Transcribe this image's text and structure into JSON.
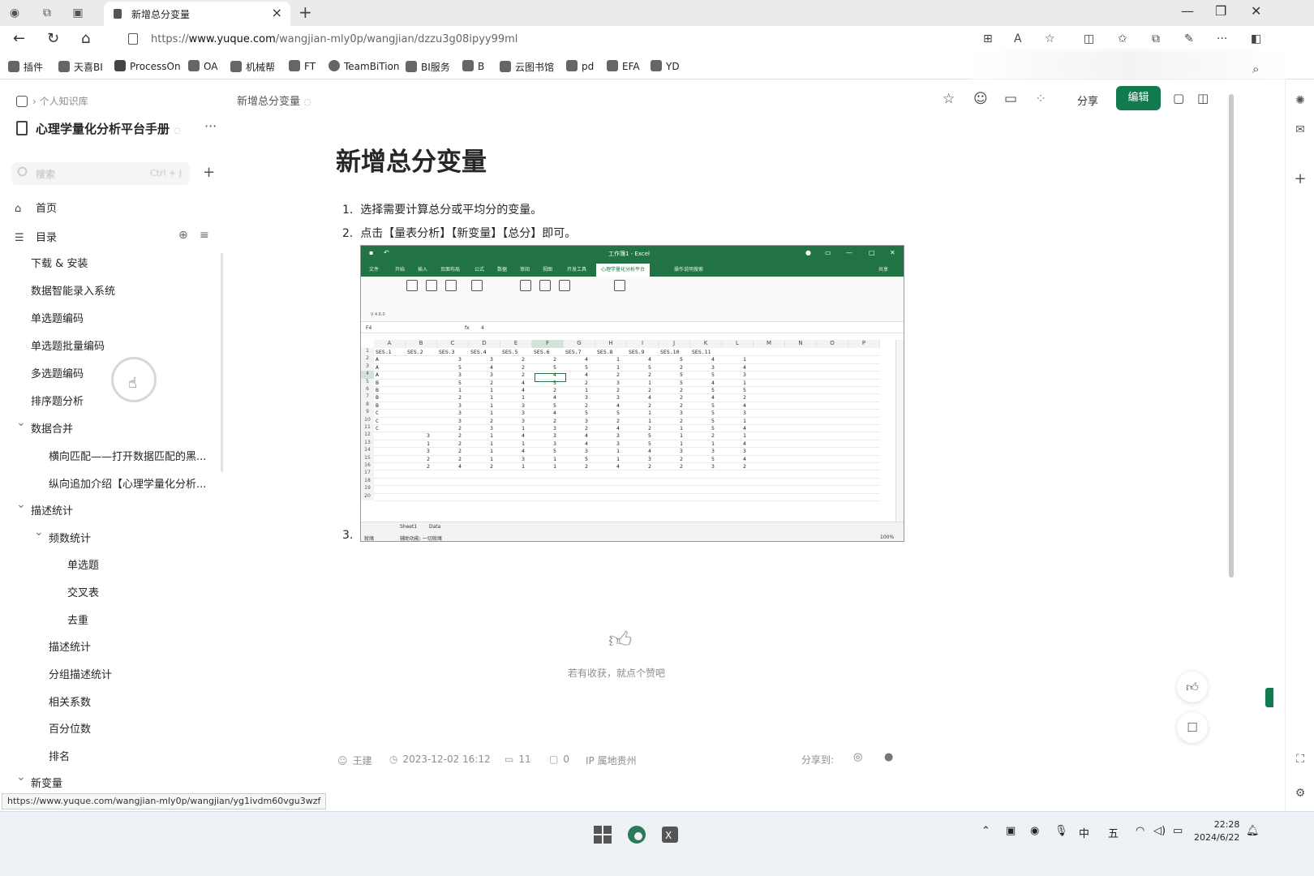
{
  "browser": {
    "tab_title": "新增总分变量",
    "url_prefix": "https://",
    "url_domain": "www.yuque.com",
    "url_path": "/wangjian-mly0p/wangjian/dzzu3g08ipyy99ml",
    "bookmarks": [
      "插件",
      "天喜BI",
      "ProcessOn",
      "OA",
      "机械帮",
      "FT",
      "TeamBiTion",
      "BI服务",
      "B",
      "云图书馆",
      "pd",
      "EFA",
      "YD"
    ],
    "status_url": "https://www.yuque.com/wangjian-mly0p/wangjian/yg1ivdm60vgu3wzf"
  },
  "sidebar": {
    "breadcrumb": "个人知识库",
    "kb_title": "心理学量化分析平台手册",
    "search_placeholder": "搜索",
    "search_shortcut": "Ctrl + J",
    "home": "首页",
    "toc_label": "目录",
    "toc": [
      {
        "label": "下载 & 安装",
        "level": 1
      },
      {
        "label": "数据智能录入系统",
        "level": 1
      },
      {
        "label": "单选题编码",
        "level": 1
      },
      {
        "label": "单选题批量编码",
        "level": 1
      },
      {
        "label": "多选题编码",
        "level": 1
      },
      {
        "label": "排序题分析",
        "level": 1
      },
      {
        "label": "数据合并",
        "level": 1,
        "expanded": true
      },
      {
        "label": "横向匹配——打开数据匹配的黑...",
        "level": 2
      },
      {
        "label": "纵向追加介绍【心理学量化分析...",
        "level": 2
      },
      {
        "label": "描述统计",
        "level": 1,
        "expanded": true
      },
      {
        "label": "频数统计",
        "level": 2,
        "expanded": true
      },
      {
        "label": "单选题",
        "level": 3
      },
      {
        "label": "交叉表",
        "level": 3
      },
      {
        "label": "去重",
        "level": 3
      },
      {
        "label": "描述统计",
        "level": 2
      },
      {
        "label": "分组描述统计",
        "level": 2
      },
      {
        "label": "相关系数",
        "level": 2
      },
      {
        "label": "百分位数",
        "level": 2
      },
      {
        "label": "排名",
        "level": 2
      },
      {
        "label": "新变量",
        "level": 1,
        "expanded": true
      }
    ]
  },
  "doc": {
    "header_title": "新增总分变量",
    "share_label": "分享",
    "edit_label": "编辑",
    "title": "新增总分变量",
    "steps": [
      "选择需要计算总分或平均分的变量。",
      "点击【量表分析】【新变量】【总分】即可。",
      ""
    ],
    "like_text": "若有收获，就点个赞吧",
    "author": "王建",
    "datetime": "2023-12-02 16:12",
    "views": "11",
    "comments": "0",
    "ip_location": "IP 属地贵州",
    "share_to": "分享到:"
  },
  "excel": {
    "title": "工作簿1 - Excel",
    "tabs": [
      "文件",
      "开始",
      "插入",
      "页面布局",
      "公式",
      "数据",
      "审阅",
      "视图",
      "开发工具",
      "心理学量化分析平台",
      "操作说明搜索"
    ],
    "share": "共享",
    "version": "V 4.6.0",
    "namebox": "F4",
    "formula": "4",
    "col_letters": [
      "A",
      "B",
      "C",
      "D",
      "E",
      "F",
      "G",
      "H",
      "I",
      "J",
      "K",
      "L",
      "M",
      "N",
      "O",
      "P"
    ],
    "headers": [
      "SES.1",
      "SES.2",
      "SES.3",
      "SES.4",
      "SES.5",
      "SES.6",
      "SES.7",
      "SES.8",
      "SES.9",
      "SES.10",
      "SES.11"
    ],
    "rows": [
      [
        "A",
        "",
        "3",
        "3",
        "2",
        "2",
        "4",
        "1",
        "4",
        "5",
        "4",
        "1"
      ],
      [
        "A",
        "",
        "5",
        "4",
        "2",
        "5",
        "5",
        "1",
        "5",
        "2",
        "3",
        "4"
      ],
      [
        "A",
        "",
        "3",
        "3",
        "2",
        "4",
        "4",
        "2",
        "2",
        "5",
        "5",
        "3"
      ],
      [
        "B",
        "",
        "5",
        "2",
        "4",
        "5",
        "2",
        "3",
        "1",
        "5",
        "4",
        "1"
      ],
      [
        "B",
        "",
        "1",
        "1",
        "4",
        "2",
        "1",
        "2",
        "2",
        "2",
        "5",
        "5"
      ],
      [
        "B",
        "",
        "2",
        "1",
        "1",
        "4",
        "3",
        "3",
        "4",
        "2",
        "4",
        "2"
      ],
      [
        "B",
        "",
        "3",
        "1",
        "3",
        "5",
        "2",
        "4",
        "2",
        "2",
        "5",
        "4"
      ],
      [
        "C",
        "",
        "3",
        "1",
        "3",
        "4",
        "5",
        "5",
        "1",
        "3",
        "5",
        "3"
      ],
      [
        "C",
        "",
        "3",
        "2",
        "3",
        "2",
        "3",
        "2",
        "1",
        "2",
        "5",
        "1"
      ],
      [
        "C",
        "",
        "2",
        "3",
        "1",
        "3",
        "2",
        "4",
        "2",
        "1",
        "5",
        "4"
      ],
      [
        "",
        "3",
        "2",
        "1",
        "4",
        "3",
        "4",
        "3",
        "5",
        "1",
        "2",
        "1"
      ],
      [
        "",
        "1",
        "2",
        "1",
        "1",
        "3",
        "4",
        "3",
        "5",
        "1",
        "1",
        "4"
      ],
      [
        "",
        "3",
        "2",
        "1",
        "4",
        "5",
        "3",
        "1",
        "4",
        "3",
        "3",
        "3"
      ],
      [
        "",
        "2",
        "2",
        "1",
        "3",
        "1",
        "5",
        "1",
        "3",
        "2",
        "5",
        "4"
      ],
      [
        "",
        "2",
        "4",
        "2",
        "1",
        "1",
        "2",
        "4",
        "2",
        "2",
        "3",
        "2"
      ]
    ],
    "sheets": [
      "Sheet1",
      "Data"
    ],
    "status_left": "就绪",
    "status_access": "辅助功能: 一切就绪",
    "zoom": "100%"
  },
  "taskbar": {
    "time": "22:28",
    "date": "2024/6/22",
    "ime1": "中",
    "ime2": "五"
  }
}
